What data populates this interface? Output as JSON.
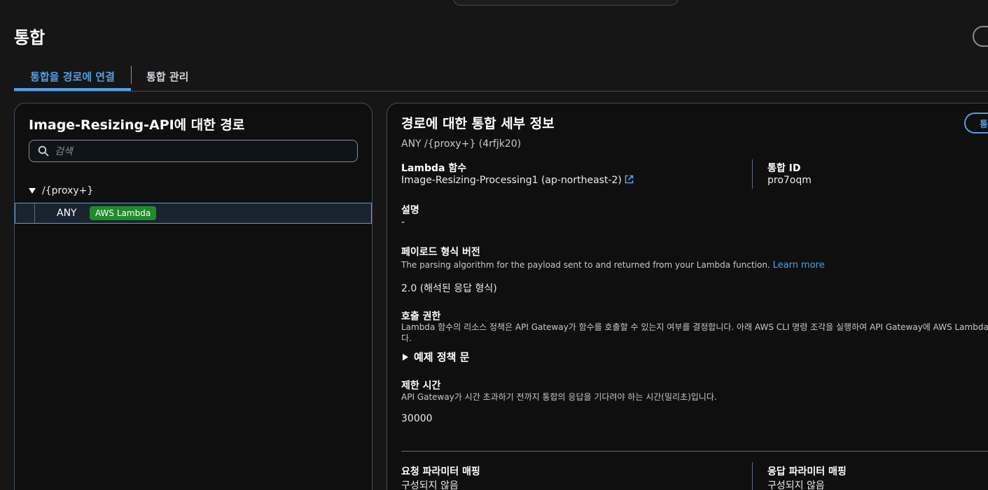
{
  "page": {
    "title": "통합"
  },
  "tabs": [
    {
      "label": "통합을 경로에 연결",
      "active": true
    },
    {
      "label": "통합 관리",
      "active": false
    }
  ],
  "routes_panel": {
    "title": "Image-Resizing-API에 대한 경로",
    "search_placeholder": "검색",
    "root_path": "/{proxy+}",
    "route": {
      "method": "ANY",
      "integration_badge": "AWS Lambda"
    }
  },
  "details_panel": {
    "title": "경로에 대한 통합 세부 정보",
    "action_button_label": "통",
    "route_summary": "ANY /{proxy+} (4rfjk20)",
    "lambda_function": {
      "label": "Lambda 함수",
      "value": "Image-Resizing-Processing1 (ap-northeast-2)"
    },
    "integration_id": {
      "label": "통합 ID",
      "value": "pro7oqm"
    },
    "description": {
      "label": "설명",
      "value": "-"
    },
    "payload_format": {
      "label": "페이로드 형식 버전",
      "description": "The parsing algorithm for the payload sent to and returned from your Lambda function.",
      "learn_more": "Learn more",
      "value": "2.0 (해석된 응답 형식)"
    },
    "invoke_permission": {
      "label": "호출 권한",
      "description_line1": "Lambda 함수의 리소스 정책은 API Gateway가 함수를 호출할 수 있는지 여부를 결정합니다. 아래 AWS CLI 명령 조각을 실행하여 API Gateway에 AWS Lambda 함수를",
      "description_line2": "다.",
      "example_toggle": "예제 정책 문"
    },
    "timeout": {
      "label": "제한 시간",
      "description": "API Gateway가 시간 초과하기 전까지 통합의 응답을 기다려야 하는 시간(밀리초)입니다.",
      "value": "30000"
    },
    "request_mapping": {
      "label": "요청 파라미터 매핑",
      "value": "구성되지 않음"
    },
    "response_mapping": {
      "label": "응답 파라미터 매핑",
      "value": "구성되지 않음"
    }
  },
  "colors": {
    "background": "#161616",
    "accent": "#539fe5",
    "badge_green": "#1f8c2a",
    "border": "#414d5c"
  }
}
